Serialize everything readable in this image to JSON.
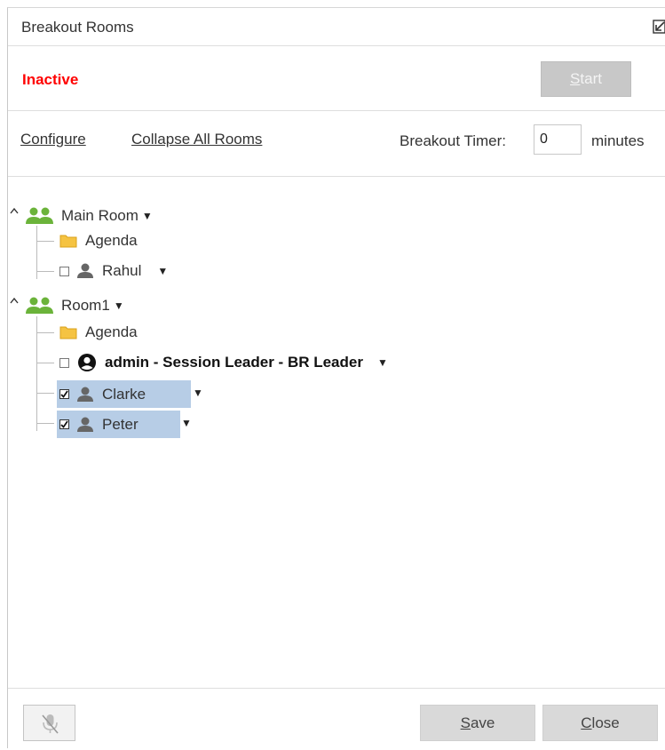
{
  "window": {
    "title": "Breakout Rooms"
  },
  "status": {
    "text": "Inactive",
    "color": "#ff0000"
  },
  "start_button": {
    "label_first": "S",
    "label_rest": "tart"
  },
  "options": {
    "configure": "Configure",
    "collapse_all": "Collapse All Rooms",
    "timer_label": "Breakout Timer:",
    "timer_value": "0",
    "timer_unit": "minutes"
  },
  "tree": {
    "main_room": {
      "name": "Main Room",
      "agenda": "Agenda",
      "members": [
        {
          "name": "Rahul",
          "checked": false
        }
      ]
    },
    "room1": {
      "name": "Room1",
      "agenda": "Agenda",
      "leader": {
        "name": "admin - Session Leader - BR Leader",
        "checked": false
      },
      "members": [
        {
          "name": "Clarke",
          "checked": true,
          "selected": true
        },
        {
          "name": "Peter",
          "checked": true,
          "selected": true
        }
      ]
    }
  },
  "footer": {
    "save_first": "S",
    "save_rest": "ave",
    "close_first": "C",
    "close_rest": "lose"
  },
  "icons": {
    "room": "people-icon",
    "agenda": "folder-icon",
    "user": "person-icon",
    "leader": "account-circle-icon",
    "mic": "mic-off-icon",
    "popout": "popout-icon"
  },
  "colors": {
    "room_icon": "#6bb33a",
    "folder": "#f5c342",
    "selection": "#b7cde6"
  }
}
